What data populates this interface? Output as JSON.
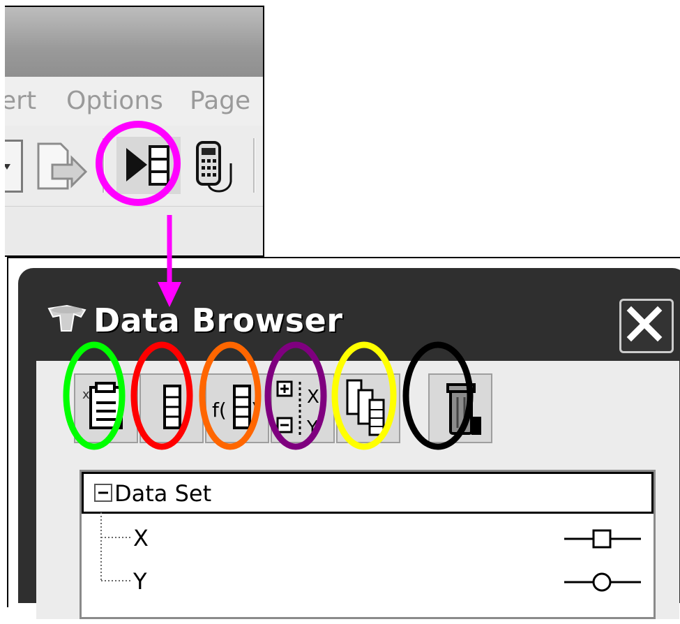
{
  "app": {
    "menu": [
      "ert",
      "Options",
      "Page"
    ]
  },
  "toolbar": {
    "icons": [
      "dropdown-arrow-icon",
      "send-to-page-icon",
      "data-browser-icon",
      "calculator-link-icon"
    ]
  },
  "data_browser": {
    "title": "Data Browser",
    "close_icon": "close-icon",
    "toolbar_buttons": [
      {
        "icon": "new-data-set-icon",
        "highlight": "#00ff00"
      },
      {
        "icon": "new-column-icon",
        "highlight": "#ff0000"
      },
      {
        "icon": "function-column-icon",
        "highlight": "#ff6600"
      },
      {
        "icon": "add-remove-variable-icon",
        "highlight": "#7f007f"
      },
      {
        "icon": "copy-columns-icon",
        "highlight": "#ffff00"
      },
      {
        "icon": "delete-icon",
        "highlight": "#000000"
      }
    ],
    "tree": {
      "root_label": "Data Set",
      "children": [
        {
          "label": "X",
          "marker": "square"
        },
        {
          "label": "Y",
          "marker": "circle"
        }
      ]
    }
  },
  "annotation": {
    "toolbar_highlight_color": "#ff00ff",
    "arrow_color": "#ff00ff"
  }
}
